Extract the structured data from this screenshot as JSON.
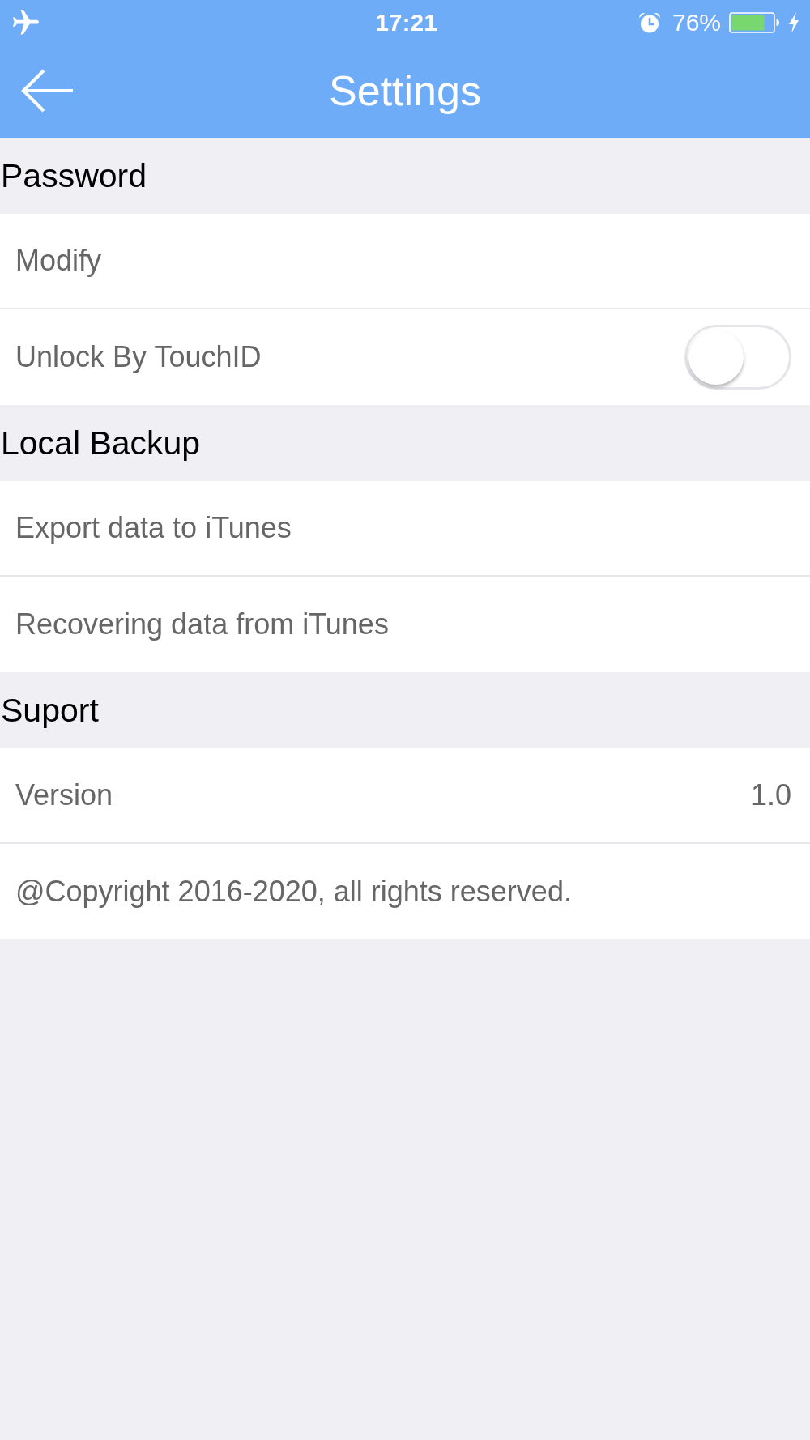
{
  "status_bar": {
    "airplane_mode": true,
    "time": "17:21",
    "alarm": true,
    "battery": "76%",
    "charging": true
  },
  "nav_bar": {
    "title": "Settings"
  },
  "sections": [
    {
      "title": "Password",
      "rows": [
        {
          "kind": "link",
          "label": "Modify"
        },
        {
          "kind": "toggle",
          "label": "Unlock By TouchID",
          "on": false
        }
      ]
    },
    {
      "title": "Local Backup",
      "rows": [
        {
          "kind": "link",
          "label": "Export data to iTunes"
        },
        {
          "kind": "link",
          "label": "Recovering data from iTunes"
        }
      ]
    },
    {
      "title": "Suport",
      "rows": [
        {
          "kind": "value",
          "label": "Version",
          "value": "1.0"
        },
        {
          "kind": "text",
          "label": "@Copyright 2016-2020, all rights reserved."
        }
      ]
    }
  ]
}
